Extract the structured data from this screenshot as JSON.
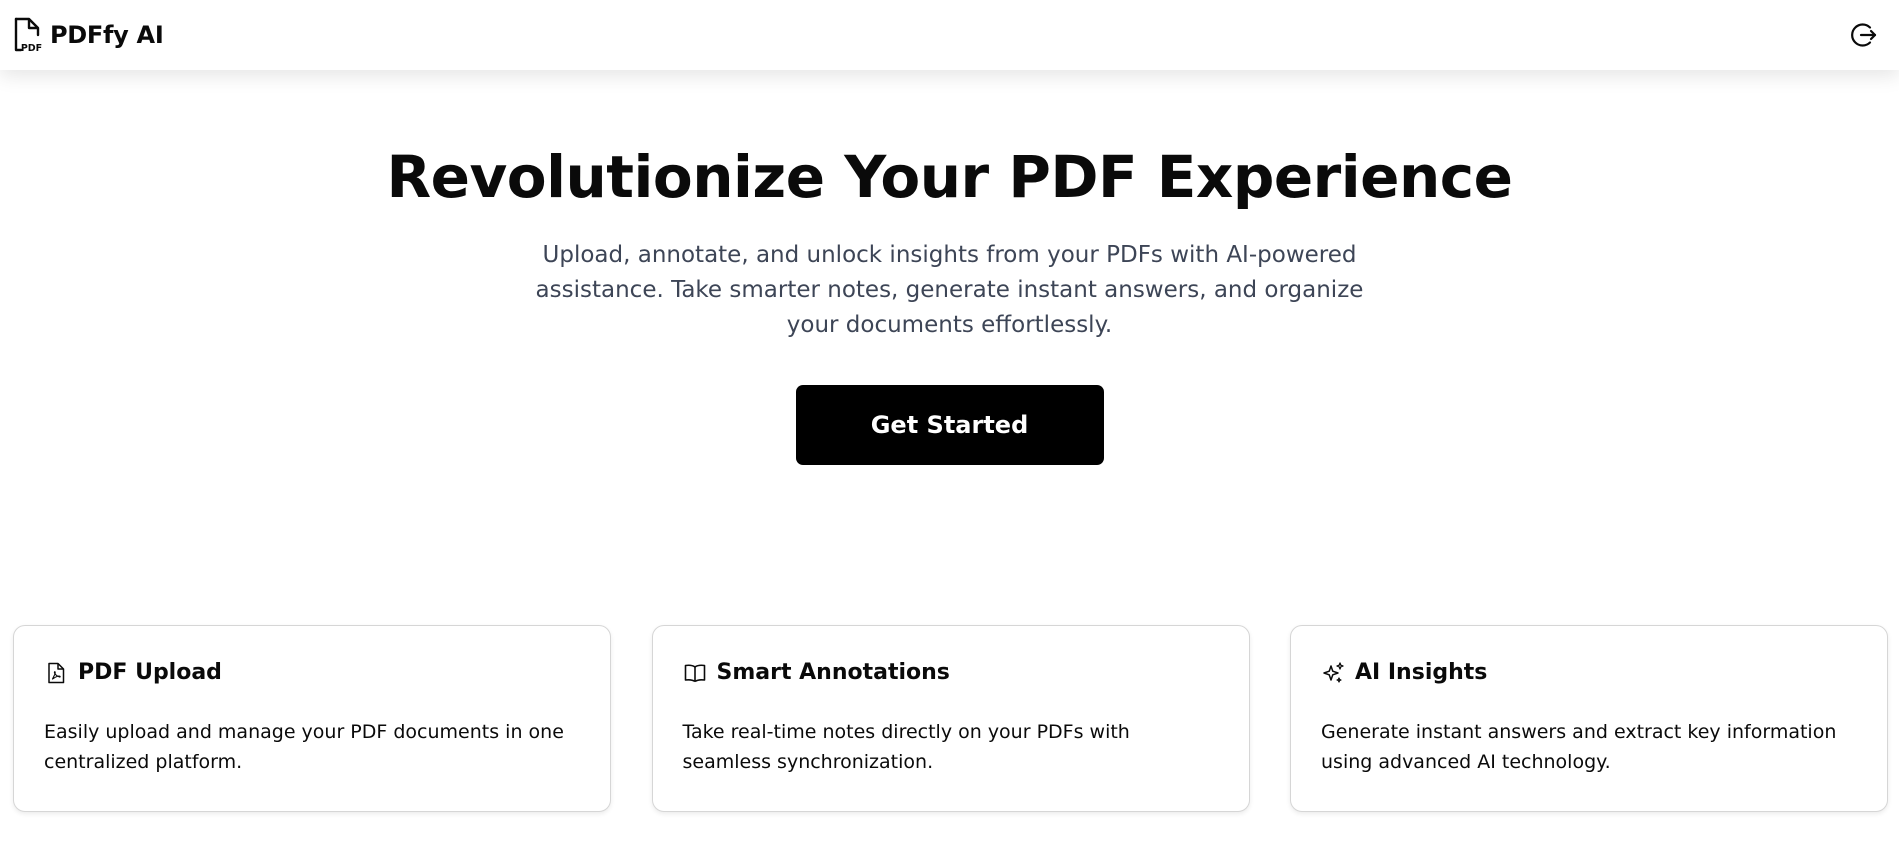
{
  "header": {
    "brand_name": "PDFfy AI",
    "logo_icon": "pdf-file-icon",
    "logo_badge": "PDF",
    "logout_icon": "logout-icon"
  },
  "hero": {
    "title": "Revolutionize Your PDF Experience",
    "subtitle": "Upload, annotate, and unlock insights from your PDFs with AI-powered assistance. Take smarter notes, generate instant answers, and organize your documents effortlessly.",
    "cta_label": "Get Started"
  },
  "features": [
    {
      "icon": "pdf-file-icon",
      "title": "PDF Upload",
      "description": "Easily upload and manage your PDF documents in one centralized platform."
    },
    {
      "icon": "open-book-icon",
      "title": "Smart Annotations",
      "description": "Take real-time notes directly on your PDFs with seamless synchronization."
    },
    {
      "icon": "sparkles-icon",
      "title": "AI Insights",
      "description": "Generate instant answers and extract key information using advanced AI technology."
    }
  ],
  "colors": {
    "cta_background": "#000000",
    "cta_text": "#ffffff",
    "subtitle_text": "#3d4556",
    "card_border": "#d6d6d6"
  }
}
